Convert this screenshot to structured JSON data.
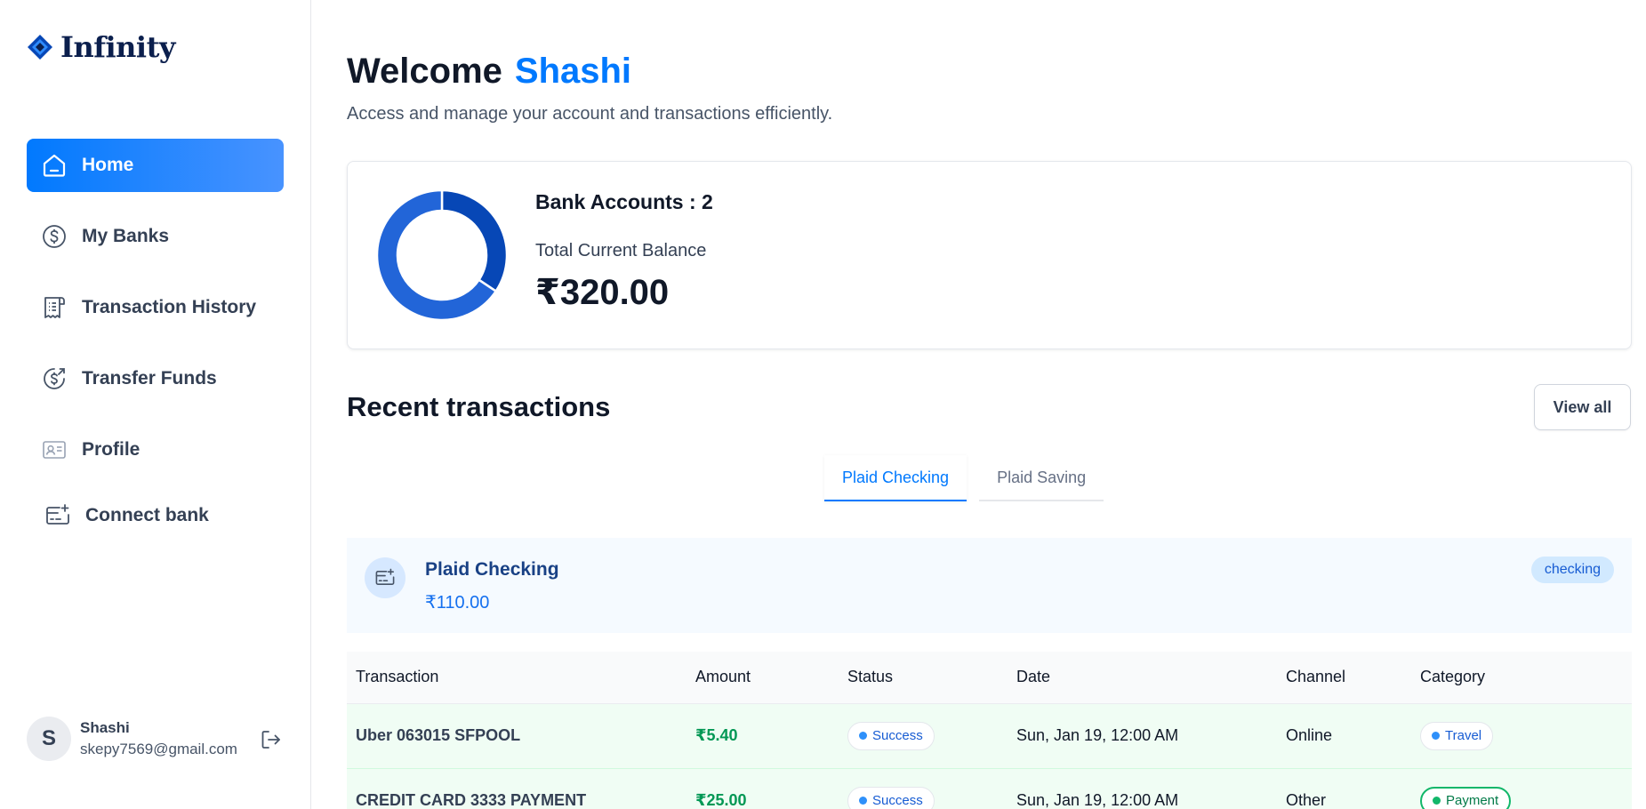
{
  "app": {
    "name": "Infinity"
  },
  "sidebar": {
    "items": [
      {
        "label": "Home",
        "icon": "home-icon",
        "active": true
      },
      {
        "label": "My Banks",
        "icon": "dollar-circle-icon"
      },
      {
        "label": "Transaction History",
        "icon": "receipt-icon"
      },
      {
        "label": "Transfer Funds",
        "icon": "money-send-icon"
      },
      {
        "label": "Profile",
        "icon": "id-card-icon"
      },
      {
        "label": "Connect bank",
        "icon": "card-add-icon"
      }
    ],
    "user": {
      "initial": "S",
      "name": "Shashi",
      "email": "skepy7569@gmail.com"
    }
  },
  "header": {
    "welcome": "Welcome",
    "name": "Shashi",
    "subtitle": "Access and manage your account and transactions efficiently."
  },
  "balance": {
    "bank_accounts_label": "Bank Accounts : 2",
    "total_label": "Total Current Balance",
    "total_amount": "₹320.00"
  },
  "chart_data": {
    "type": "pie",
    "categories": [
      "Plaid Checking",
      "Plaid Saving"
    ],
    "values": [
      110,
      210
    ],
    "colors": [
      "#0747b6",
      "#2265d8"
    ]
  },
  "recent": {
    "title": "Recent transactions",
    "view_all": "View all",
    "tabs": [
      {
        "label": "Plaid Checking",
        "active": true
      },
      {
        "label": "Plaid Saving",
        "active": false
      }
    ]
  },
  "bank": {
    "name": "Plaid Checking",
    "balance": "₹110.00",
    "type": "checking"
  },
  "table": {
    "headers": [
      "Transaction",
      "Amount",
      "Status",
      "Date",
      "Channel",
      "Category"
    ],
    "rows": [
      {
        "name": "Uber 063015 SFPOOL",
        "amount": "₹5.40",
        "status": "Success",
        "date": "Sun, Jan 19, 12:00 AM",
        "channel": "Online",
        "category": "Travel"
      },
      {
        "name": "CREDIT CARD 3333 PAYMENT",
        "amount": "₹25.00",
        "status": "Success",
        "date": "Sun, Jan 19, 12:00 AM",
        "channel": "Other",
        "category": "Payment"
      }
    ]
  },
  "colors": {
    "accent": "#0179fe",
    "success": "#039855",
    "row_bg": "#f0fdf4",
    "bank_bg": "#f5faff"
  }
}
